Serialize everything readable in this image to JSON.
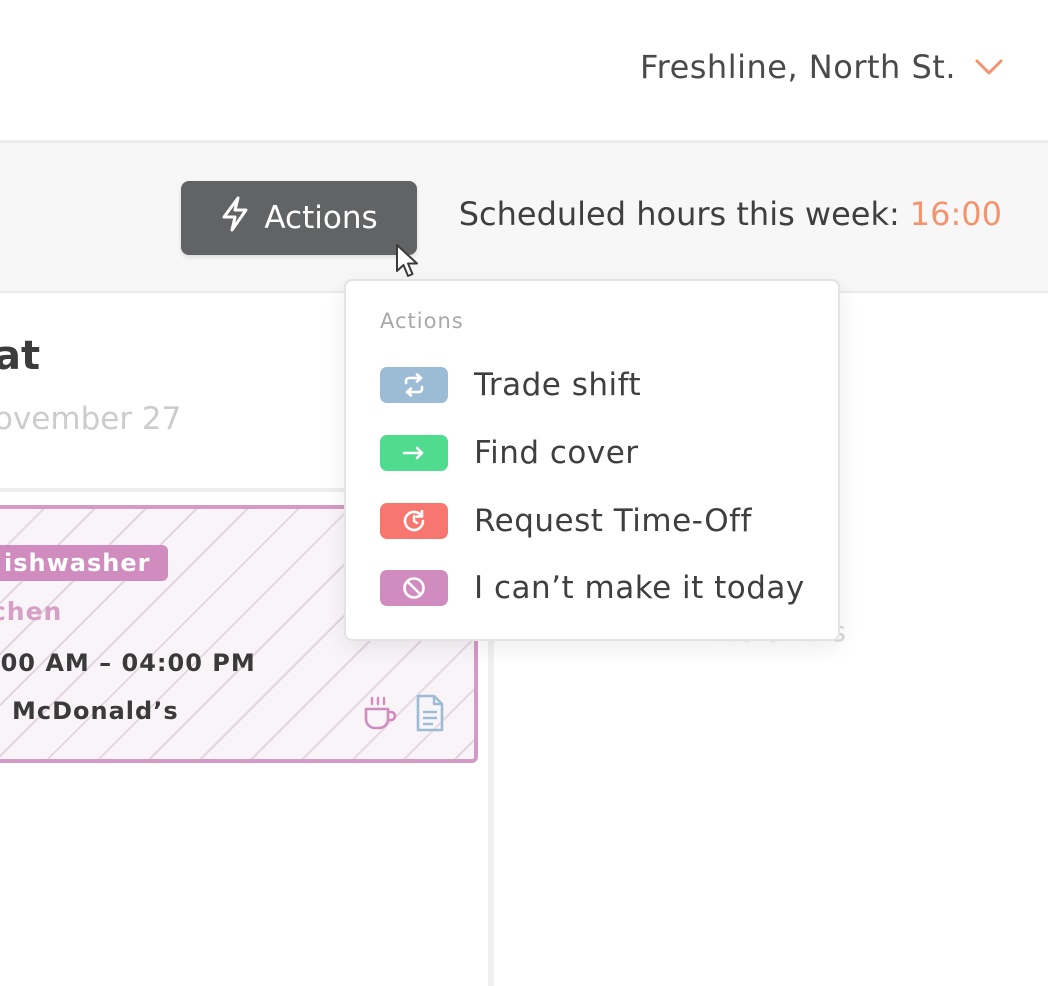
{
  "header": {
    "location": "Freshline, North St.",
    "location_icon": "chevron-down-icon",
    "accent_color": "#f3946f"
  },
  "toolbar": {
    "actions_label": "Actions",
    "actions_icon": "lightning-icon",
    "scheduled_label": "Scheduled hours this week:",
    "scheduled_value": "16:00"
  },
  "day": {
    "title": "at",
    "date": "ovember 27"
  },
  "shift": {
    "role": "ishwasher",
    "area": "tchen",
    "time": ":00 AM – 04:00 PM",
    "location": "McDonald’s",
    "icons": [
      "coffee-cup-icon",
      "document-icon"
    ],
    "color": "#d08cbe"
  },
  "next_day": {
    "empty_text": "No shifts"
  },
  "actions_menu": {
    "heading": "Actions",
    "items": [
      {
        "label": "Trade shift",
        "icon": "swap-arrows-icon",
        "color": "#9cbcd6"
      },
      {
        "label": "Find cover",
        "icon": "arrow-right-icon",
        "color": "#4fdc8f"
      },
      {
        "label": "Request Time-Off",
        "icon": "clock-refresh-icon",
        "color": "#f77770"
      },
      {
        "label": "I can’t make it today",
        "icon": "prohibited-icon",
        "color": "#d08cbe"
      }
    ]
  }
}
